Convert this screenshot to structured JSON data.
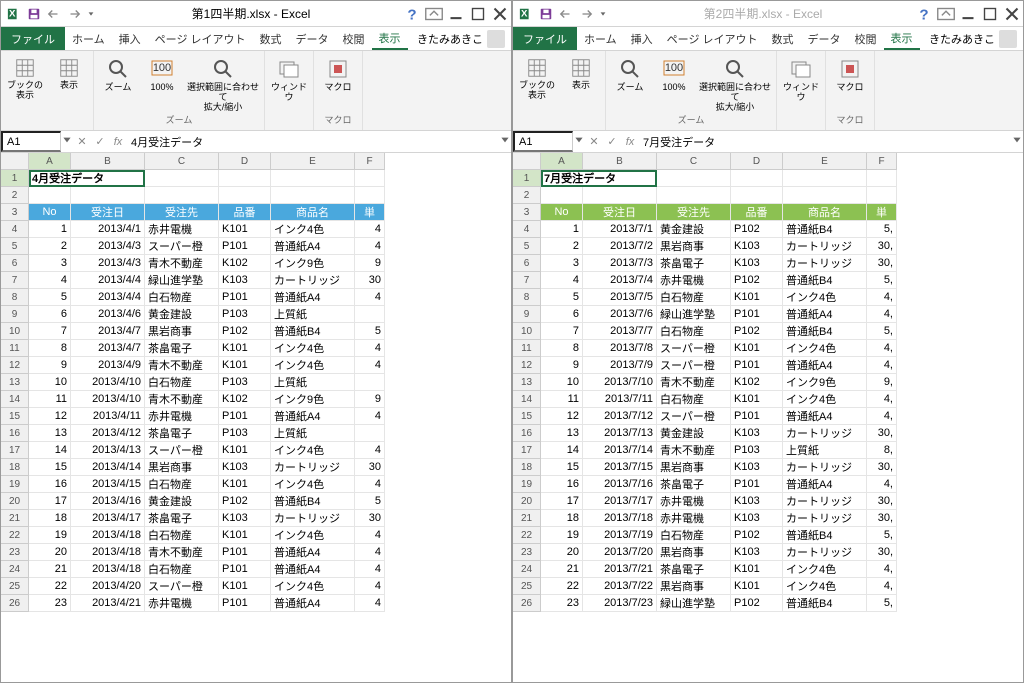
{
  "pane1": {
    "title": "第1四半期.xlsx - Excel",
    "user": "きたみあきこ",
    "cellRef": "A1",
    "formula": "4月受注データ",
    "sheetTitle": "4月受注データ",
    "headerClass": "blue"
  },
  "pane2": {
    "title": "第2四半期.xlsx - Excel",
    "user": "きたみあきこ",
    "cellRef": "A1",
    "formula": "7月受注データ",
    "sheetTitle": "7月受注データ",
    "headerClass": "green"
  },
  "menus": [
    "ホーム",
    "挿入",
    "ページ レイアウト",
    "数式",
    "データ",
    "校閲",
    "表示"
  ],
  "fileLabel": "ファイル",
  "ribbon": {
    "book_view": "ブックの\n表示",
    "show": "表示",
    "zoom": "ズーム",
    "pct100": "100%",
    "fit_sel": "選択範囲に合わせて\n拡大/縮小",
    "window": "ウィンドウ",
    "macro": "マクロ",
    "g_zoom": "ズーム",
    "g_macro": "マクロ"
  },
  "cols": [
    "A",
    "B",
    "C",
    "D",
    "E",
    "F"
  ],
  "headers": [
    "No",
    "受注日",
    "受注先",
    "品番",
    "商品名",
    "単"
  ],
  "rows1": [
    [
      "1",
      "2013/4/1",
      "赤井電機",
      "K101",
      "インク4色",
      "4"
    ],
    [
      "2",
      "2013/4/3",
      "スーパー橙",
      "P101",
      "普通紙A4",
      "4"
    ],
    [
      "3",
      "2013/4/3",
      "青木不動産",
      "K102",
      "インク9色",
      "9"
    ],
    [
      "4",
      "2013/4/4",
      "緑山進学塾",
      "K103",
      "カートリッジ",
      "30"
    ],
    [
      "5",
      "2013/4/4",
      "白石物産",
      "P101",
      "普通紙A4",
      "4"
    ],
    [
      "6",
      "2013/4/6",
      "黄金建設",
      "P103",
      "上質紙",
      ""
    ],
    [
      "7",
      "2013/4/7",
      "黒岩商事",
      "P102",
      "普通紙B4",
      "5"
    ],
    [
      "8",
      "2013/4/7",
      "茶畠電子",
      "K101",
      "インク4色",
      "4"
    ],
    [
      "9",
      "2013/4/9",
      "青木不動産",
      "K101",
      "インク4色",
      "4"
    ],
    [
      "10",
      "2013/4/10",
      "白石物産",
      "P103",
      "上質紙",
      ""
    ],
    [
      "11",
      "2013/4/10",
      "青木不動産",
      "K102",
      "インク9色",
      "9"
    ],
    [
      "12",
      "2013/4/11",
      "赤井電機",
      "P101",
      "普通紙A4",
      "4"
    ],
    [
      "13",
      "2013/4/12",
      "茶畠電子",
      "P103",
      "上質紙",
      ""
    ],
    [
      "14",
      "2013/4/13",
      "スーパー橙",
      "K101",
      "インク4色",
      "4"
    ],
    [
      "15",
      "2013/4/14",
      "黒岩商事",
      "K103",
      "カートリッジ",
      "30"
    ],
    [
      "16",
      "2013/4/15",
      "白石物産",
      "K101",
      "インク4色",
      "4"
    ],
    [
      "17",
      "2013/4/16",
      "黄金建設",
      "P102",
      "普通紙B4",
      "5"
    ],
    [
      "18",
      "2013/4/17",
      "茶畠電子",
      "K103",
      "カートリッジ",
      "30"
    ],
    [
      "19",
      "2013/4/18",
      "白石物産",
      "K101",
      "インク4色",
      "4"
    ],
    [
      "20",
      "2013/4/18",
      "青木不動産",
      "P101",
      "普通紙A4",
      "4"
    ],
    [
      "21",
      "2013/4/18",
      "白石物産",
      "P101",
      "普通紙A4",
      "4"
    ],
    [
      "22",
      "2013/4/20",
      "スーパー橙",
      "K101",
      "インク4色",
      "4"
    ],
    [
      "23",
      "2013/4/21",
      "赤井電機",
      "P101",
      "普通紙A4",
      "4"
    ]
  ],
  "rows2": [
    [
      "1",
      "2013/7/1",
      "黄金建設",
      "P102",
      "普通紙B4",
      "5,"
    ],
    [
      "2",
      "2013/7/2",
      "黒岩商事",
      "K103",
      "カートリッジ",
      "30,"
    ],
    [
      "3",
      "2013/7/3",
      "茶畠電子",
      "K103",
      "カートリッジ",
      "30,"
    ],
    [
      "4",
      "2013/7/4",
      "赤井電機",
      "P102",
      "普通紙B4",
      "5,"
    ],
    [
      "5",
      "2013/7/5",
      "白石物産",
      "K101",
      "インク4色",
      "4,"
    ],
    [
      "6",
      "2013/7/6",
      "緑山進学塾",
      "P101",
      "普通紙A4",
      "4,"
    ],
    [
      "7",
      "2013/7/7",
      "白石物産",
      "P102",
      "普通紙B4",
      "5,"
    ],
    [
      "8",
      "2013/7/8",
      "スーパー橙",
      "K101",
      "インク4色",
      "4,"
    ],
    [
      "9",
      "2013/7/9",
      "スーパー橙",
      "P101",
      "普通紙A4",
      "4,"
    ],
    [
      "10",
      "2013/7/10",
      "青木不動産",
      "K102",
      "インク9色",
      "9,"
    ],
    [
      "11",
      "2013/7/11",
      "白石物産",
      "K101",
      "インク4色",
      "4,"
    ],
    [
      "12",
      "2013/7/12",
      "スーパー橙",
      "P101",
      "普通紙A4",
      "4,"
    ],
    [
      "13",
      "2013/7/13",
      "黄金建設",
      "K103",
      "カートリッジ",
      "30,"
    ],
    [
      "14",
      "2013/7/14",
      "青木不動産",
      "P103",
      "上質紙",
      "8,"
    ],
    [
      "15",
      "2013/7/15",
      "黒岩商事",
      "K103",
      "カートリッジ",
      "30,"
    ],
    [
      "16",
      "2013/7/16",
      "茶畠電子",
      "P101",
      "普通紙A4",
      "4,"
    ],
    [
      "17",
      "2013/7/17",
      "赤井電機",
      "K103",
      "カートリッジ",
      "30,"
    ],
    [
      "18",
      "2013/7/18",
      "赤井電機",
      "K103",
      "カートリッジ",
      "30,"
    ],
    [
      "19",
      "2013/7/19",
      "白石物産",
      "P102",
      "普通紙B4",
      "5,"
    ],
    [
      "20",
      "2013/7/20",
      "黒岩商事",
      "K103",
      "カートリッジ",
      "30,"
    ],
    [
      "21",
      "2013/7/21",
      "茶畠電子",
      "K101",
      "インク4色",
      "4,"
    ],
    [
      "22",
      "2013/7/22",
      "黒岩商事",
      "K101",
      "インク4色",
      "4,"
    ],
    [
      "23",
      "2013/7/23",
      "緑山進学塾",
      "P102",
      "普通紙B4",
      "5,"
    ]
  ]
}
